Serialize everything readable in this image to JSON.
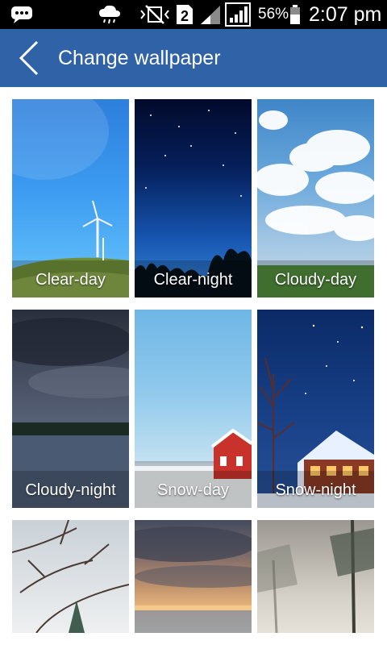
{
  "status_bar": {
    "battery": "56%",
    "time": "2:07 pm",
    "sim_slot": "2",
    "icons": [
      "chat-icon",
      "rain-cloud-icon",
      "vibrate-mute-icon",
      "sim-2-icon",
      "signal-icon",
      "signal-boxed-icon",
      "battery-icon"
    ]
  },
  "header": {
    "title": "Change wallpaper",
    "back_icon": "chevron-left-icon",
    "background": "#2f62a6"
  },
  "wallpapers": [
    {
      "label": "Clear-day"
    },
    {
      "label": "Clear-night"
    },
    {
      "label": "Cloudy-day"
    },
    {
      "label": "Cloudy-night"
    },
    {
      "label": "Snow-day"
    },
    {
      "label": "Snow-night"
    },
    {
      "label": ""
    },
    {
      "label": ""
    },
    {
      "label": ""
    }
  ]
}
